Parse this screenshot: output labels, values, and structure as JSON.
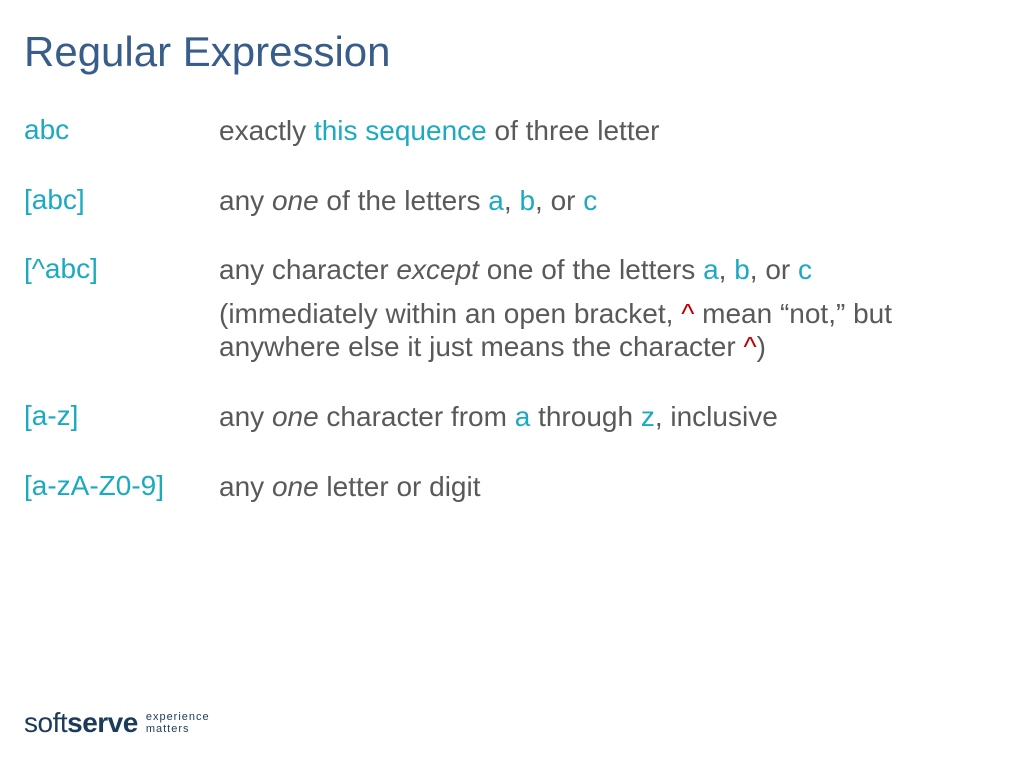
{
  "title": "Regular Expression",
  "rows": [
    {
      "pattern": "abc",
      "desc_prefix": "exactly ",
      "desc_cyan": "this sequence",
      "desc_suffix": " of three letter"
    },
    {
      "pattern": "[abc]",
      "desc_1": "any ",
      "desc_italic": "one",
      "desc_2": " of the letters ",
      "desc_a": "a",
      "desc_3": ", ",
      "desc_b": "b",
      "desc_4": ", or ",
      "desc_c": "c"
    },
    {
      "pattern": "[^abc]",
      "desc_1": "any character ",
      "desc_italic": "except",
      "desc_2": " one of the letters ",
      "desc_a": "a",
      "desc_3": ", ",
      "desc_b": "b",
      "desc_4": ", or ",
      "desc_c": "c",
      "note_1": "(immediately within an open bracket, ",
      "note_caret1": "^",
      "note_2": " mean “not,” but anywhere else it just means the character ",
      "note_caret2": "^",
      "note_3": ")"
    },
    {
      "pattern": "[a-z]",
      "desc_1": "any ",
      "desc_italic": "one",
      "desc_2": " character from ",
      "desc_a": "a",
      "desc_3": " through ",
      "desc_z": "z",
      "desc_4": ", inclusive"
    },
    {
      "pattern": "[a-zA-Z0-9]",
      "desc_1": "any ",
      "desc_italic": "one",
      "desc_2": " letter or digit"
    }
  ],
  "footer": {
    "brand_light": "soft",
    "brand_bold": "serve",
    "tagline_1": "experience",
    "tagline_2": "matters"
  }
}
